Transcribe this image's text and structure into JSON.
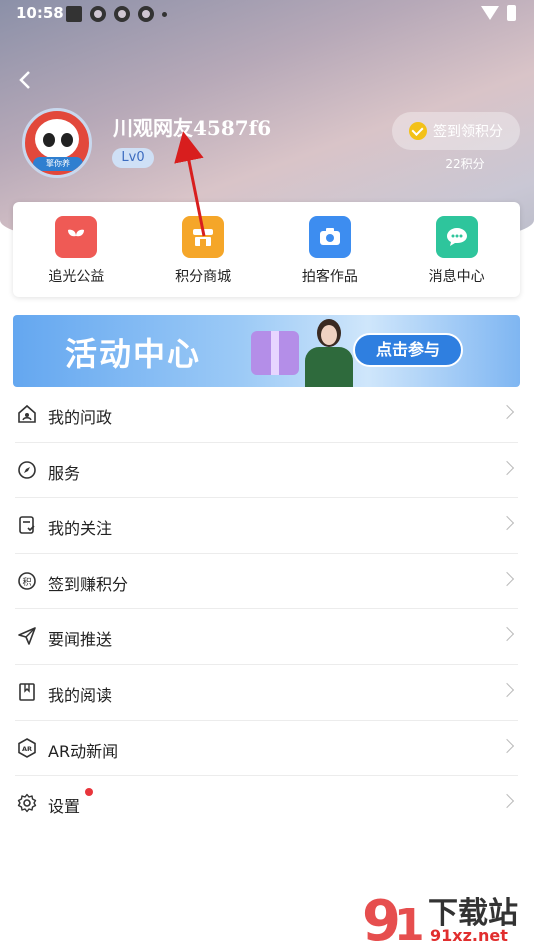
{
  "status_bar": {
    "time": "10:58"
  },
  "profile": {
    "username": "川观网友4587f6",
    "level": "Lv0",
    "avatar_tag": "擎你养",
    "signin_label": "签到领积分",
    "points": "22积分"
  },
  "quick_menu": [
    {
      "label": "追光公益",
      "icon": "sprout-icon",
      "color": "#ef5a55"
    },
    {
      "label": "积分商城",
      "icon": "shop-icon",
      "color": "#f5a629"
    },
    {
      "label": "拍客作品",
      "icon": "camera-icon",
      "color": "#3d8df0"
    },
    {
      "label": "消息中心",
      "icon": "chat-icon",
      "color": "#2ec59c"
    }
  ],
  "banner": {
    "title": "活动中心",
    "button": "点击参与"
  },
  "menu": [
    {
      "label": "我的问政",
      "icon": "house-icon"
    },
    {
      "label": "服务",
      "icon": "compass-icon"
    },
    {
      "label": "我的关注",
      "icon": "follow-icon"
    },
    {
      "label": "签到赚积分",
      "icon": "points-icon"
    },
    {
      "label": "要闻推送",
      "icon": "send-icon"
    },
    {
      "label": "我的阅读",
      "icon": "bookmark-icon"
    },
    {
      "label": "AR动新闻",
      "icon": "ar-icon"
    },
    {
      "label": "设置",
      "icon": "gear-icon"
    }
  ],
  "watermark": {
    "brand": "下载站",
    "url": "91xz.net"
  }
}
